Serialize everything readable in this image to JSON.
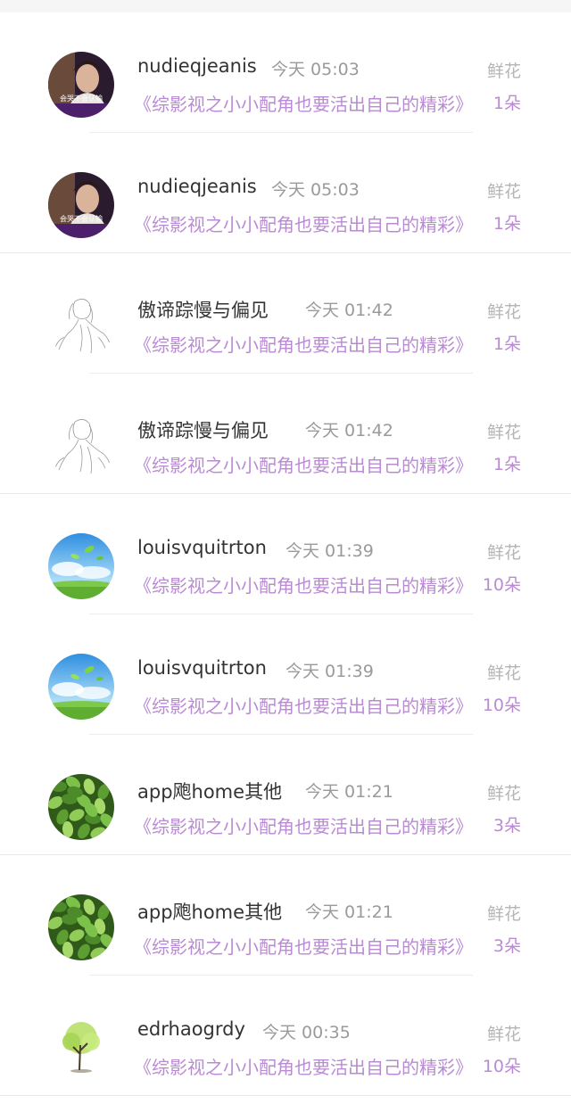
{
  "list": {
    "items": [
      {
        "name": "nudieqjeanis",
        "time": "今天 05:03",
        "label": "鲜花",
        "title": "《综影视之小小配角也要活出自己的精彩》",
        "count": "1朵",
        "avatar": "portrait",
        "avatar_text": "会哭不会认输"
      },
      {
        "name": "nudieqjeanis",
        "time": "今天 05:03",
        "label": "鲜花",
        "title": "《综影视之小小配角也要活出自己的精彩》",
        "count": "1朵",
        "avatar": "portrait",
        "avatar_text": "会哭不会认输"
      },
      {
        "name": "傲谛踪慢与偏见",
        "time": "今天 01:42",
        "label": "鲜花",
        "title": "《综影视之小小配角也要活出自己的精彩》",
        "count": "1朵",
        "avatar": "sketch"
      },
      {
        "name": "傲谛踪慢与偏见",
        "time": "今天 01:42",
        "label": "鲜花",
        "title": "《综影视之小小配角也要活出自己的精彩》",
        "count": "1朵",
        "avatar": "sketch"
      },
      {
        "name": "louisvquitrton",
        "time": "今天 01:39",
        "label": "鲜花",
        "title": "《综影视之小小配角也要活出自己的精彩》",
        "count": "10朵",
        "avatar": "sky"
      },
      {
        "name": "louisvquitrton",
        "time": "今天 01:39",
        "label": "鲜花",
        "title": "《综影视之小小配角也要活出自己的精彩》",
        "count": "10朵",
        "avatar": "sky"
      },
      {
        "name": "app飑home其他",
        "time": "今天 01:21",
        "label": "鲜花",
        "title": "《综影视之小小配角也要活出自己的精彩》",
        "count": "3朵",
        "avatar": "leaves"
      },
      {
        "name": "app飑home其他",
        "time": "今天 01:21",
        "label": "鲜花",
        "title": "《综影视之小小配角也要活出自己的精彩》",
        "count": "3朵",
        "avatar": "leaves"
      },
      {
        "name": "edrhaogrdy",
        "time": "今天 00:35",
        "label": "鲜花",
        "title": "《综影视之小小配角也要活出自己的精彩》",
        "count": "10朵",
        "avatar": "tree"
      }
    ]
  },
  "colors": {
    "accent": "#b98bd2",
    "name_text": "#333333",
    "time_text": "#9a9a9a",
    "label_text": "#b5b5b5"
  }
}
